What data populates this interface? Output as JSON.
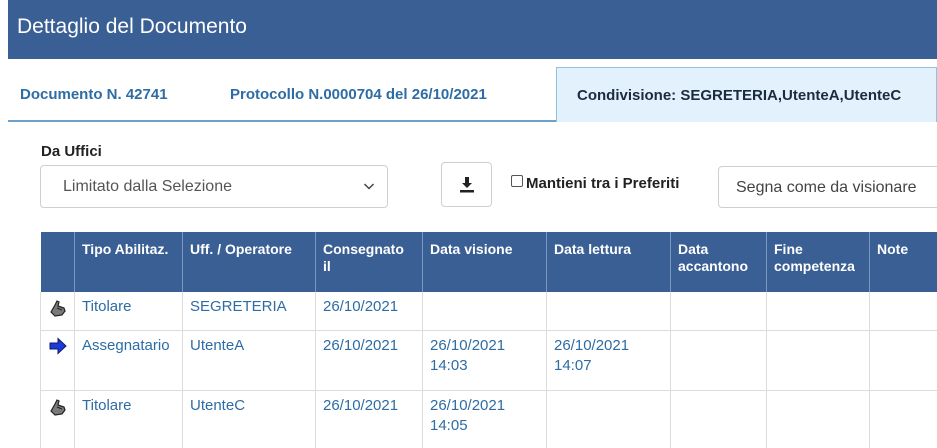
{
  "header": {
    "title": "Dettaglio del Documento"
  },
  "tabs": [
    {
      "label": "Documento N. 42741"
    },
    {
      "label": "Protocollo N.0000704 del 26/10/2021"
    },
    {
      "label": "Condivisione: SEGRETERIA,UtenteA,UtenteC"
    }
  ],
  "filters": {
    "uffici_label": "Da Uffici",
    "uffici_value": "Limitato dalla Selezione",
    "preferiti_label": "Mantieni tra i Preferiti",
    "segna_label": "Segna come da visionare"
  },
  "icons": {
    "dropdown": "chevron-down-icon",
    "download": "download-icon",
    "titolare": "hand-icon",
    "assegnatario": "arrow-right-icon"
  },
  "colors": {
    "header_bg": "#3a5f94",
    "link": "#2d6ca4",
    "active_tab_bg": "#e2f1fb"
  },
  "table": {
    "columns": [
      "Tipo Abilitaz.",
      "Uff. / Operatore",
      "Consegnato il",
      "Data visione",
      "Data lettura",
      "Data accantono",
      "Fine competenza",
      "Note"
    ],
    "rows": [
      {
        "icon": "hand-icon",
        "tipo": "Titolare",
        "operatore": "SEGRETERIA",
        "consegnato": "26/10/2021",
        "visione_date": "",
        "visione_time": "",
        "lettura_date": "",
        "lettura_time": "",
        "accantono": "",
        "fine": "",
        "note": ""
      },
      {
        "icon": "arrow-right-icon",
        "tipo": "Assegnatario",
        "operatore": "UtenteA",
        "consegnato": "26/10/2021",
        "visione_date": "26/10/2021",
        "visione_time": "14:03",
        "lettura_date": "26/10/2021",
        "lettura_time": "14:07",
        "accantono": "",
        "fine": "",
        "note": ""
      },
      {
        "icon": "hand-icon",
        "tipo": "Titolare",
        "operatore": "UtenteC",
        "consegnato": "26/10/2021",
        "visione_date": "26/10/2021",
        "visione_time": "14:05",
        "lettura_date": "",
        "lettura_time": "",
        "accantono": "",
        "fine": "",
        "note": ""
      }
    ]
  }
}
